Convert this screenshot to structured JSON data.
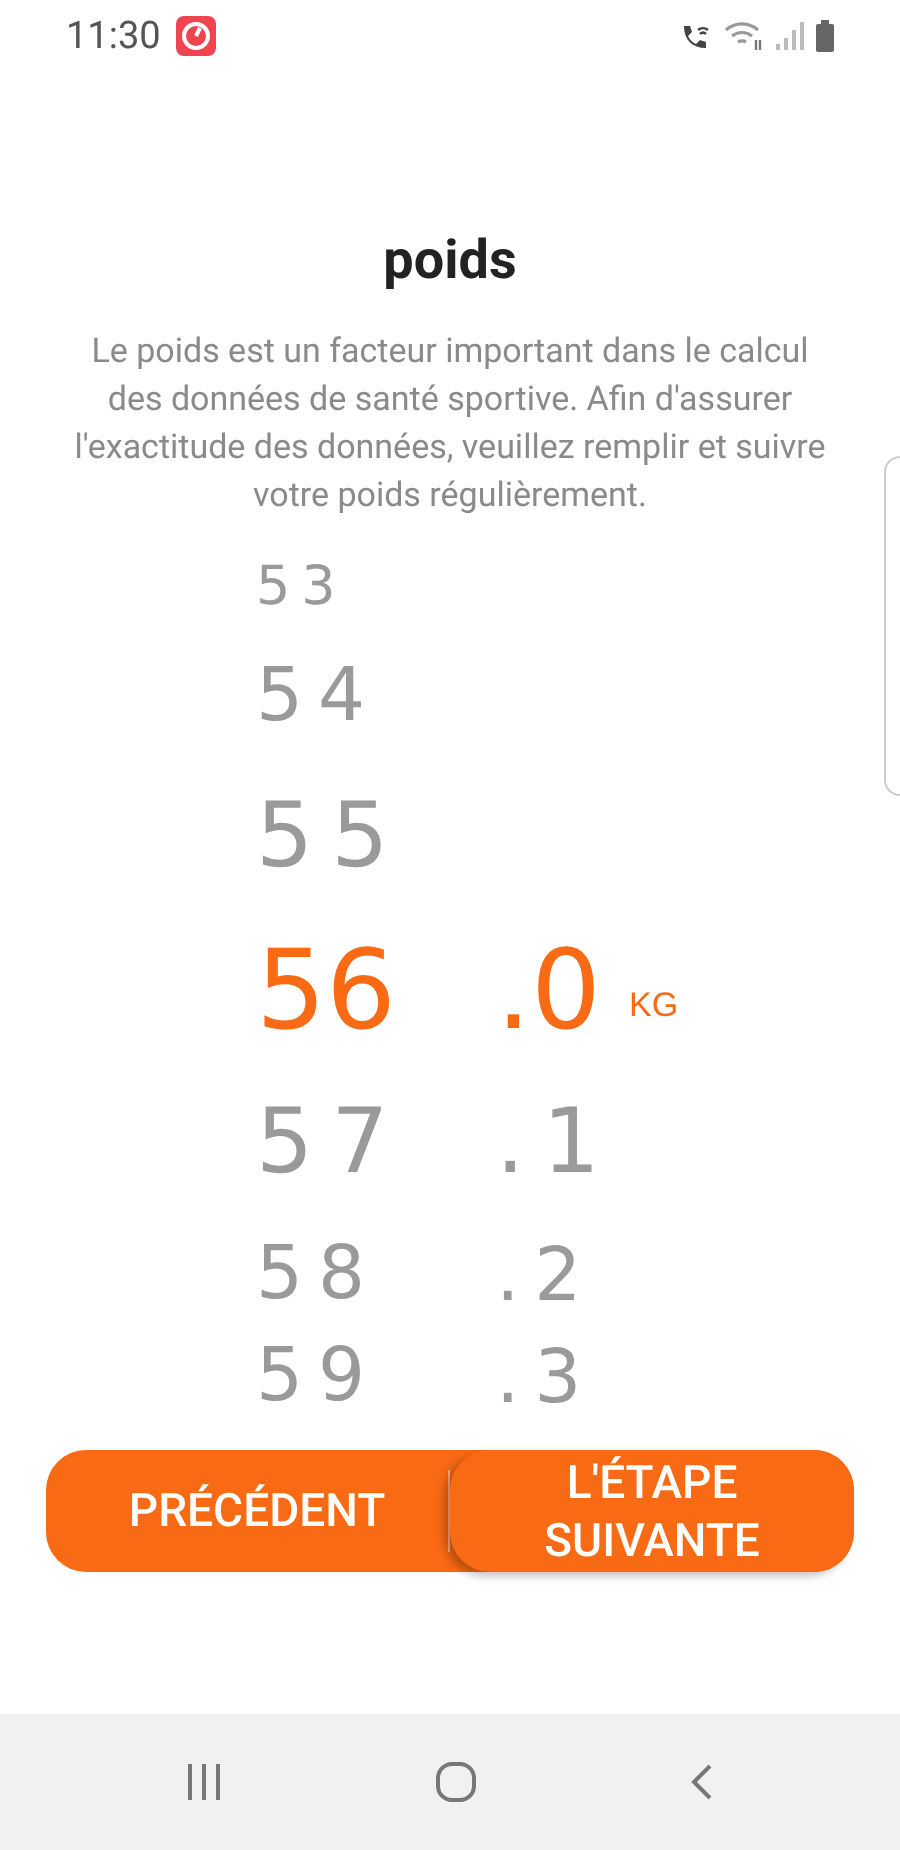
{
  "status_bar": {
    "time": "11:30"
  },
  "title": "poids",
  "description": "Le poids est un facteur important dans le calcul des données de santé sportive. Afin d'assurer l'exactitude des données, veuillez remplir et suivre votre poids régulièrement.",
  "picker": {
    "rows": [
      {
        "integer": "53",
        "selected": false
      },
      {
        "integer": "54",
        "selected": false
      },
      {
        "integer": "55",
        "selected": false
      },
      {
        "integer": "56",
        "decimal": ".0",
        "unit": "KG",
        "selected": true
      },
      {
        "integer": "57",
        "decimal": ".1",
        "selected": false
      },
      {
        "integer": "58",
        "decimal": ".2",
        "selected": false
      },
      {
        "integer": "59",
        "decimal": ".3",
        "selected": false
      }
    ]
  },
  "buttons": [
    {
      "label": "PRÉCÉDENT",
      "kind": "back"
    },
    {
      "label": "L'ÉTAPE SUIVANTE",
      "kind": "next"
    }
  ]
}
